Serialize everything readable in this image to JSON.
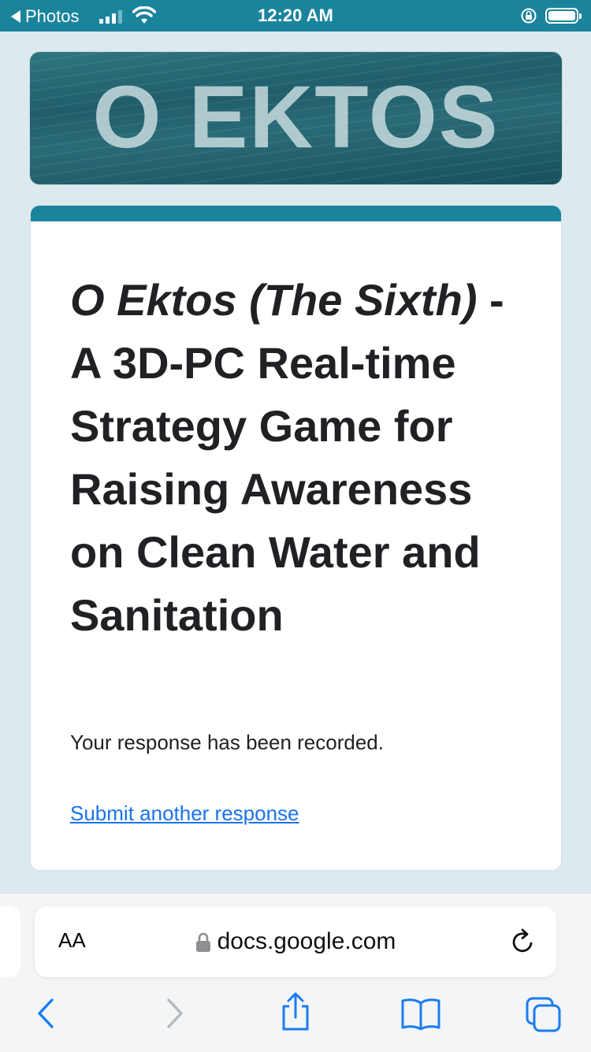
{
  "status_bar": {
    "back_app": "Photos",
    "time": "12:20 AM",
    "icons": [
      "back-arrow-icon",
      "signal-icon",
      "wifi-icon",
      "orientation-lock-icon",
      "battery-icon"
    ]
  },
  "banner": {
    "text": "O EKTOS"
  },
  "form": {
    "title_italic": "O Ektos (The Sixth)",
    "title_rest": " - A 3D-PC Real-time Strategy Game for Raising Awareness on Clean Water and Sanitation",
    "confirmation": "Your response has been recorded.",
    "another_link": "Submit another response",
    "accent_color": "#1b849d",
    "link_color": "#1a73e8"
  },
  "browser": {
    "text_size_label": "AA",
    "url": "docs.google.com",
    "icons": [
      "lock-icon",
      "reload-icon",
      "back-icon",
      "forward-icon",
      "share-icon",
      "bookmarks-icon",
      "tabs-icon"
    ],
    "icon_color": "#1a7cf0"
  }
}
